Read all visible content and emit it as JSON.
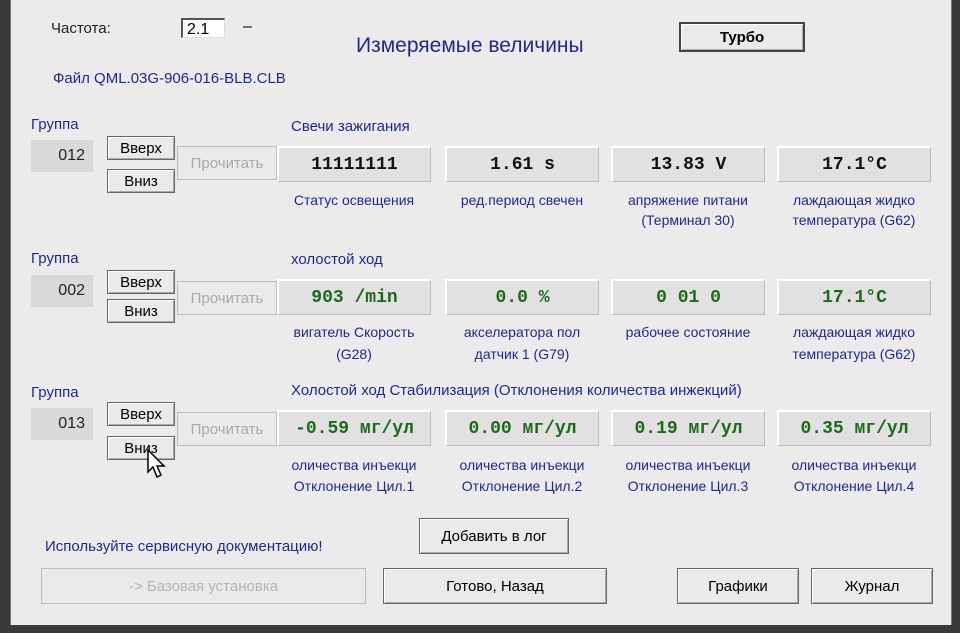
{
  "header": {
    "freq_label": "Частота:",
    "freq_value": "2.1",
    "freq_suffix": "–",
    "title": "Измеряемые величины",
    "turbo_label": "Турбо",
    "file_label": "Файл QML.03G-906-016-BLB.CLB"
  },
  "groups": [
    {
      "label": "Группа",
      "number": "012",
      "up_label": "Вверх",
      "down_label": "Вниз",
      "read_label": "Прочитать",
      "title": "Свечи зажигания",
      "values": [
        {
          "value": "11111111",
          "desc1": "Статус освещения",
          "desc2": ""
        },
        {
          "value": "1.61 s",
          "desc1": "ред.период свечен",
          "desc2": ""
        },
        {
          "value": "13.83 V",
          "desc1": "апряжение питани",
          "desc2": "(Терминал 30)"
        },
        {
          "value": "17.1°C",
          "desc1": "лаждающая жидко",
          "desc2": "температура (G62)"
        }
      ]
    },
    {
      "label": "Группа",
      "number": "002",
      "up_label": "Вверх",
      "down_label": "Вниз",
      "read_label": "Прочитать",
      "title": "холостой ход",
      "values": [
        {
          "value": "903 /min",
          "desc1": "вигатель Скорость",
          "desc2": "(G28)"
        },
        {
          "value": "0.0 %",
          "desc1": "акселератора пол",
          "desc2": "датчик 1 (G79)"
        },
        {
          "value": "0 01  0",
          "desc1": "рабочее состояние",
          "desc2": ""
        },
        {
          "value": "17.1°C",
          "desc1": "лаждающая жидко",
          "desc2": "температура (G62)"
        }
      ]
    },
    {
      "label": "Группа",
      "number": "013",
      "up_label": "Вверх",
      "down_label": "Вниз",
      "read_label": "Прочитать",
      "title": "Холостой ход Стабилизация (Отклонения количества инжекций)",
      "values": [
        {
          "value": "-0.59 мг/ул",
          "desc1": "оличества инъекци",
          "desc2": "Отклонение Цил.1"
        },
        {
          "value": "0.00 мг/ул",
          "desc1": "оличества инъекци",
          "desc2": "Отклонение Цил.2"
        },
        {
          "value": "0.19 мг/ул",
          "desc1": "оличества инъекци",
          "desc2": "Отклонение Цил.3"
        },
        {
          "value": "0.35 мг/ул",
          "desc1": "оличества инъекци",
          "desc2": "Отклонение Цил.4"
        }
      ]
    }
  ],
  "footer": {
    "note": "Используйте сервисную документацию!",
    "add_log_label": "Добавить в лог",
    "basic_settings_label": "-> Базовая установка",
    "done_label": "Готово, Назад",
    "graphs_label": "Графики",
    "journal_label": "Журнал"
  },
  "colors": {
    "label_blue": "#1d2a8c",
    "value_green": "#1b6b1b",
    "window_bg": "#eceaea"
  }
}
